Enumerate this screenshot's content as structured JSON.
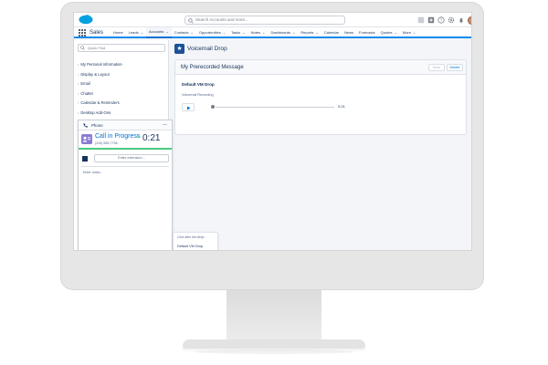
{
  "header": {
    "search_placeholder": "Search Accounts and more..."
  },
  "nav": {
    "app_name": "Sales",
    "items": [
      {
        "label": "Home",
        "caret": false,
        "active": false
      },
      {
        "label": "Leads",
        "caret": true,
        "active": false
      },
      {
        "label": "Accounts",
        "caret": true,
        "active": true
      },
      {
        "label": "Contacts",
        "caret": true,
        "active": false
      },
      {
        "label": "Opportunities",
        "caret": true,
        "active": false
      },
      {
        "label": "Tasks",
        "caret": true,
        "active": false
      },
      {
        "label": "Notes",
        "caret": true,
        "active": false
      },
      {
        "label": "Dashboards",
        "caret": true,
        "active": false
      },
      {
        "label": "Reports",
        "caret": true,
        "active": false
      },
      {
        "label": "Calendar",
        "caret": false,
        "active": false
      },
      {
        "label": "News",
        "caret": false,
        "active": false
      },
      {
        "label": "Forecasts",
        "caret": false,
        "active": false
      },
      {
        "label": "Quotes",
        "caret": true,
        "active": false
      },
      {
        "label": "More",
        "caret": true,
        "active": false
      }
    ]
  },
  "sidebar": {
    "quick_find_placeholder": "Quick Find",
    "items": [
      {
        "label": "My Personal Information"
      },
      {
        "label": "Display & Layout"
      },
      {
        "label": "Email"
      },
      {
        "label": "Chatter"
      },
      {
        "label": "Calendar & Reminders"
      },
      {
        "label": "Desktop Add-Ons"
      }
    ]
  },
  "page": {
    "title": "Voicemail Drop"
  },
  "card": {
    "title": "My Prerecorded Message",
    "save_label": "Save",
    "delete_label": "Delete",
    "recording_name": "Default VM Drop",
    "recording_label": "Voicemail Recording",
    "duration": "0:21"
  },
  "phone": {
    "title": "Phone",
    "minimize_label": "—",
    "call_status": "Call in Progress",
    "call_number": "(415) 555-7756",
    "call_timer": "0:21",
    "hd_label": "HD",
    "extension_placeholder": "Enter extension...",
    "notes_placeholder": "Enter notes...",
    "vm_menu_hint": "Click after the beep...",
    "vm_menu_item": "Default VM Drop"
  },
  "colors": {
    "brand_blue": "#0070d2",
    "nav_accent": "#1589ee",
    "call_green": "#4bca81",
    "text_dark": "#16325c"
  }
}
